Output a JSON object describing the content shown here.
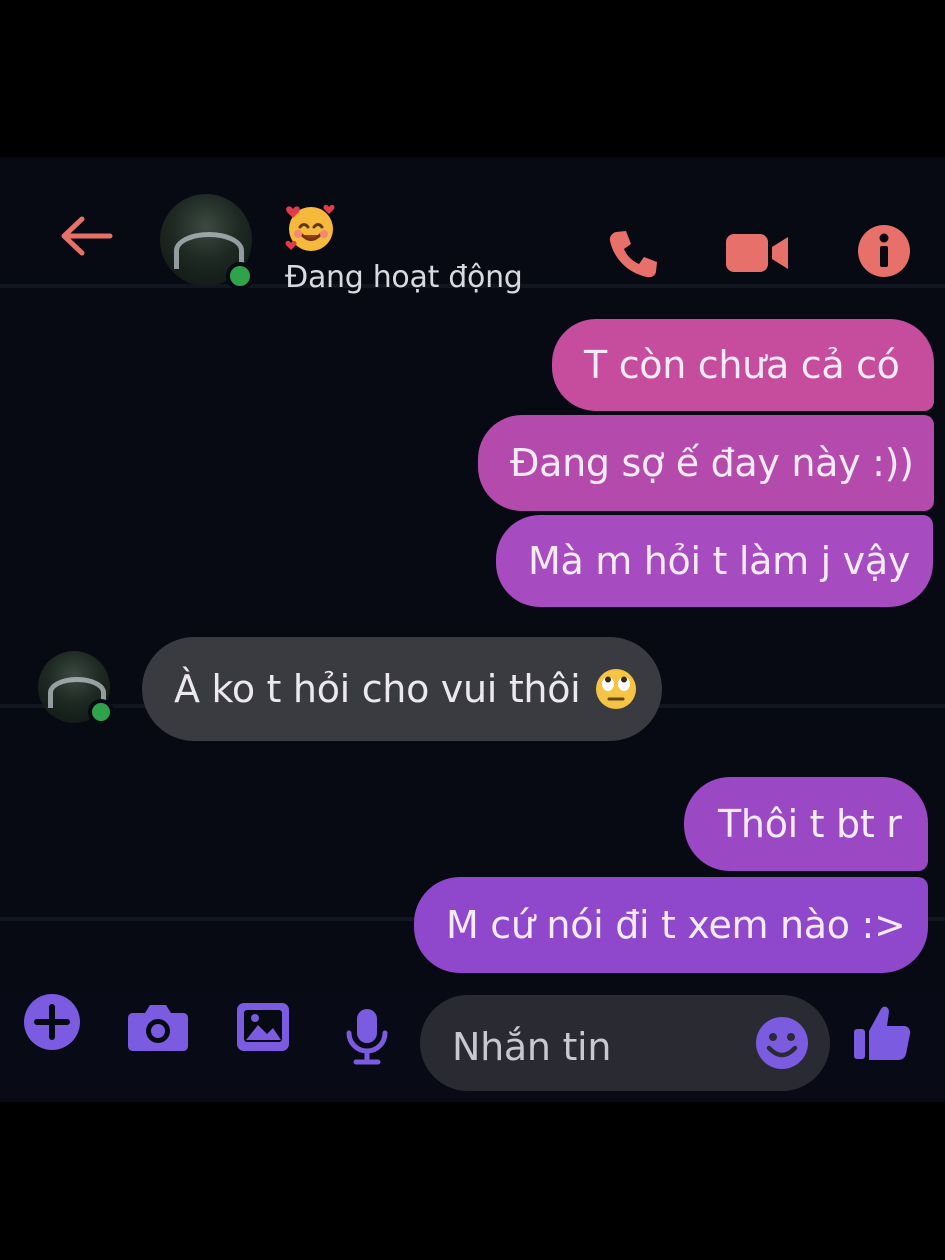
{
  "colors": {
    "accent_header": "#e8706a",
    "accent_composer": "#7b5ce0",
    "online": "#31a24c",
    "bubble_received": "#3a3b41"
  },
  "header": {
    "back_icon": "arrow-left-icon",
    "name_emoji": "smiling-face-with-hearts-emoji",
    "status": "Đang hoạt động",
    "actions": [
      "phone-icon",
      "video-camera-icon",
      "info-icon"
    ]
  },
  "messages": [
    {
      "sender": "me",
      "text": "T còn chưa cả có"
    },
    {
      "sender": "me",
      "text": "Đang sợ ế đay này :))"
    },
    {
      "sender": "me",
      "text": "Mà m hỏi t làm j vậy"
    },
    {
      "sender": "them",
      "text": "À ko t hỏi cho vui thôi",
      "emoji": "face-with-rolling-eyes-emoji"
    },
    {
      "sender": "me",
      "text": "Thôi t bt r"
    },
    {
      "sender": "me",
      "text": "M cứ nói đi t xem nào :>"
    }
  ],
  "composer": {
    "tools": [
      "plus-icon",
      "camera-icon",
      "image-icon",
      "microphone-icon"
    ],
    "placeholder": "Nhắn tin",
    "emoji_icon": "smiley-icon",
    "send_icon": "thumbs-up-icon"
  }
}
